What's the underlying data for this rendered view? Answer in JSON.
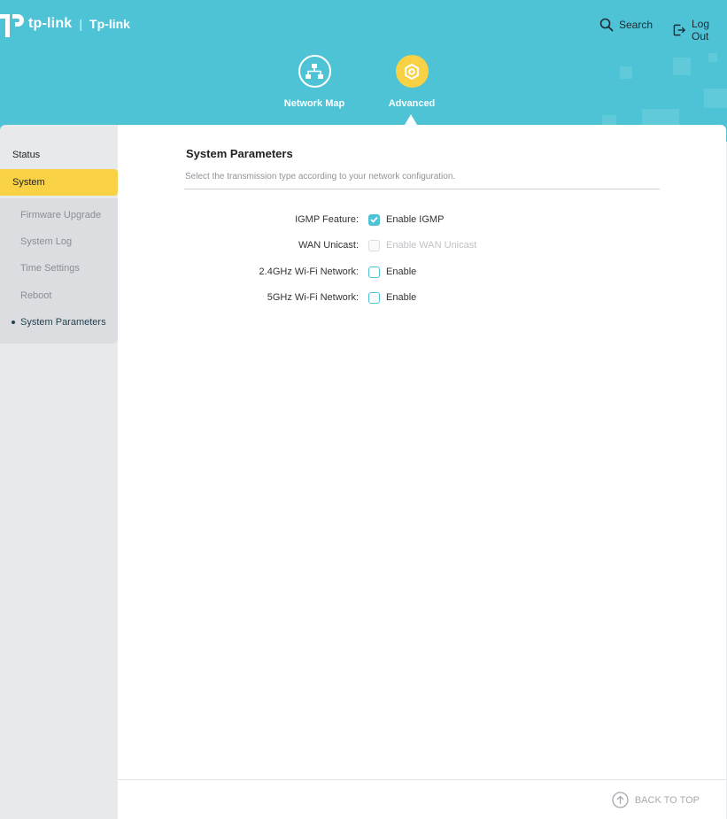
{
  "brand": {
    "logo_text": "tp-link",
    "model": "Tp-link"
  },
  "top_actions": {
    "search": "Search",
    "logout": "Log Out"
  },
  "nav": {
    "network_map": "Network Map",
    "advanced": "Advanced"
  },
  "sidebar": {
    "status": "Status",
    "system": "System",
    "subitems": [
      "Firmware Upgrade",
      "System Log",
      "Time Settings",
      "Reboot",
      "System Parameters"
    ],
    "current": "System Parameters"
  },
  "section": {
    "title": "System Parameters",
    "description": "Select the transmission type according to your network configuration."
  },
  "settings": [
    {
      "label": "IGMP Feature:",
      "option": "Enable IGMP",
      "checked": true,
      "disabled": false
    },
    {
      "label": "WAN Unicast:",
      "option": "Enable WAN Unicast",
      "checked": false,
      "disabled": true
    },
    {
      "label": "2.4GHz Wi-Fi Network:",
      "option": "Enable",
      "checked": false,
      "disabled": false
    },
    {
      "label": "5GHz Wi-Fi Network:",
      "option": "Enable",
      "checked": false,
      "disabled": false
    }
  ],
  "footer": {
    "back_to_top": "BACK TO TOP"
  },
  "colors": {
    "header": "#4ec3d6",
    "accent_yellow": "#f9d145",
    "checkbox": "#4ec3d6"
  }
}
